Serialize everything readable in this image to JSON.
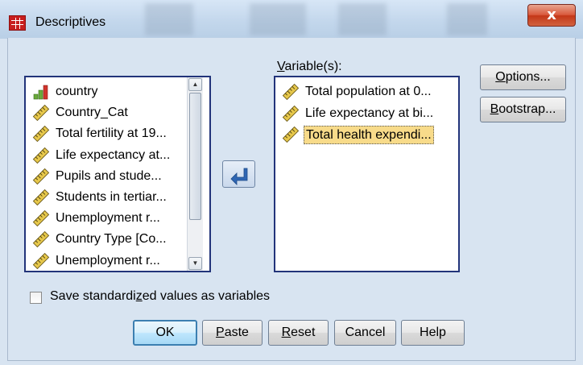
{
  "window": {
    "title": "Descriptives",
    "close_glyph": "x"
  },
  "source_list": {
    "items": [
      {
        "label": "country",
        "icon": "nominal-bar-icon"
      },
      {
        "label": "Country_Cat",
        "icon": "scale-ruler-icon"
      },
      {
        "label": "Total fertility at 19...",
        "icon": "scale-ruler-icon"
      },
      {
        "label": "Life expectancy at...",
        "icon": "scale-ruler-icon"
      },
      {
        "label": "Pupils and stude...",
        "icon": "scale-ruler-icon"
      },
      {
        "label": "Students in tertiar...",
        "icon": "scale-ruler-icon"
      },
      {
        "label": "Unemployment r...",
        "icon": "scale-ruler-icon"
      },
      {
        "label": "Country Type [Co...",
        "icon": "scale-ruler-icon"
      },
      {
        "label": "Unemployment r...",
        "icon": "scale-ruler-icon"
      }
    ]
  },
  "variables": {
    "label_prefix": "V",
    "label_rest": "ariable(s):",
    "items": [
      {
        "label": "Total population at 0...",
        "icon": "scale-ruler-icon",
        "selected": false
      },
      {
        "label": "Life expectancy at bi...",
        "icon": "scale-ruler-icon",
        "selected": false
      },
      {
        "label": "Total health expendi...",
        "icon": "scale-ruler-icon",
        "selected": true
      }
    ]
  },
  "side_buttons": {
    "options": {
      "mnemonic": "O",
      "rest": "ptions..."
    },
    "bootstrap": {
      "mnemonic": "B",
      "rest": "ootstrap..."
    }
  },
  "checkbox": {
    "label_before": "Save standardi",
    "label_mnemonic": "z",
    "label_after": "ed values as variables",
    "checked": false
  },
  "footer_buttons": {
    "ok": "OK",
    "paste": {
      "mnemonic": "P",
      "rest": "aste"
    },
    "reset": {
      "mnemonic": "R",
      "rest": "eset"
    },
    "cancel": "Cancel",
    "help": "Help"
  },
  "colors": {
    "dialog_bg": "#d8e4f1",
    "list_border": "#22347a",
    "selection": "#f8db8a",
    "close_button": "#c43718"
  }
}
